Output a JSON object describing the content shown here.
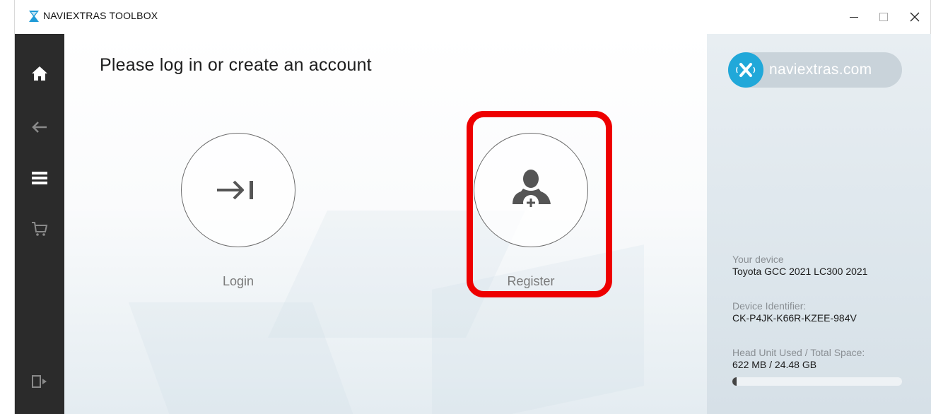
{
  "window": {
    "title": "NAVIEXTRAS TOOLBOX",
    "controls": {
      "minimize": "—",
      "maximize": "□",
      "close": "✕"
    }
  },
  "sidebar": {
    "items": [
      {
        "name": "home",
        "icon": "home-icon"
      },
      {
        "name": "back",
        "icon": "arrow-left-icon"
      },
      {
        "name": "menu",
        "icon": "hamburger-menu-icon"
      },
      {
        "name": "cart",
        "icon": "cart-icon"
      },
      {
        "name": "logout",
        "icon": "logout-icon"
      }
    ]
  },
  "main": {
    "title": "Please log in or create an account",
    "actions": {
      "login": {
        "label": "Login",
        "icon": "login-arrow-icon"
      },
      "register": {
        "label": "Register",
        "icon": "add-user-icon"
      }
    },
    "highlight_color": "#ee0000"
  },
  "info_panel": {
    "brand": {
      "text": "naviextras.com",
      "color": "#21a8d9"
    },
    "device": {
      "label": "Your device",
      "value": "Toyota GCC 2021 LC300 2021"
    },
    "identifier": {
      "label": "Device Identifier:",
      "value": "CK-P4JK-K66R-KZEE-984V"
    },
    "space": {
      "label": "Head Unit Used / Total Space:",
      "value": "622 MB / 24.48 GB",
      "used_fraction": 0.025
    }
  }
}
